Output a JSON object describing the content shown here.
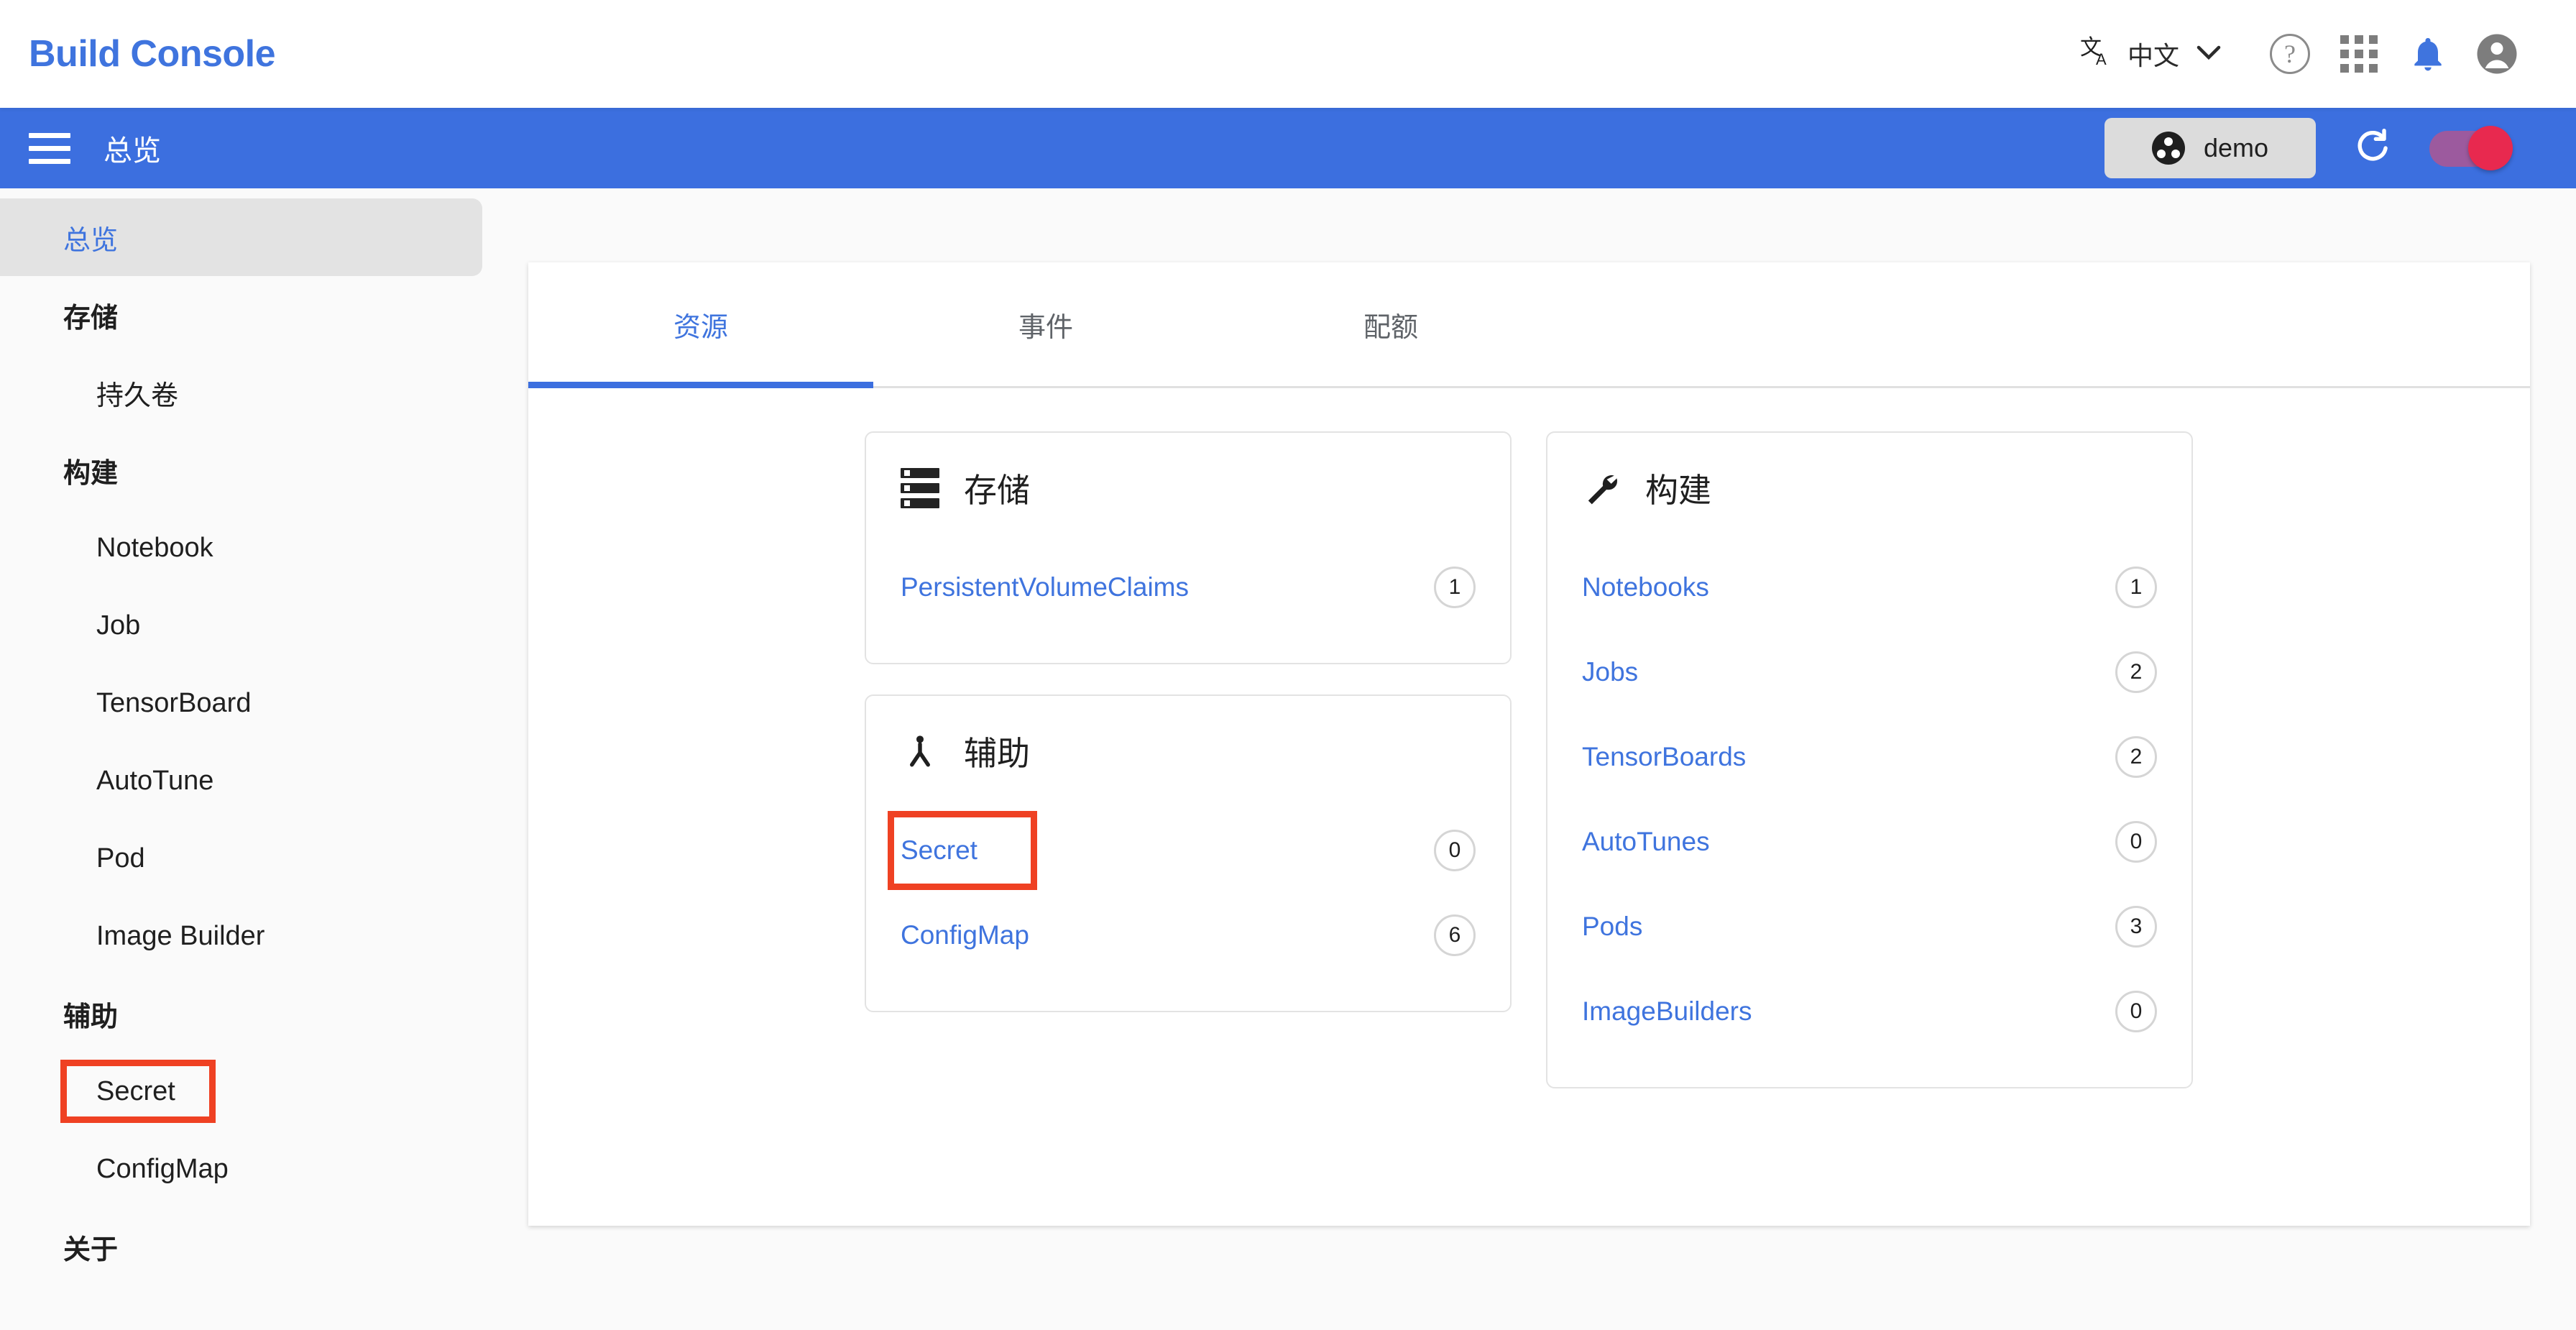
{
  "header": {
    "brand": "Build Console",
    "language_label": "中文",
    "translate_icon": "translate-icon",
    "chevron": "⌄",
    "help_glyph": "?",
    "icons": [
      "translate-icon",
      "help-icon",
      "apps-grid-icon",
      "notifications-bell-icon",
      "account-avatar-icon"
    ]
  },
  "toolbar": {
    "menu_icon": "hamburger-menu-icon",
    "page_title": "总览",
    "namespace": "demo",
    "refresh_icon": "refresh-icon",
    "toggle_state": "on",
    "colors": {
      "bar": "#3c6fdf",
      "toggle_thumb": "#e8294f",
      "toggle_track": "#9c5a9e"
    }
  },
  "sidebar": {
    "items": [
      {
        "label": "总览",
        "type": "item",
        "active": true
      },
      {
        "label": "存储",
        "type": "group"
      },
      {
        "label": "持久卷",
        "type": "child"
      },
      {
        "label": "构建",
        "type": "group"
      },
      {
        "label": "Notebook",
        "type": "child"
      },
      {
        "label": "Job",
        "type": "child"
      },
      {
        "label": "TensorBoard",
        "type": "child"
      },
      {
        "label": "AutoTune",
        "type": "child"
      },
      {
        "label": "Pod",
        "type": "child"
      },
      {
        "label": "Image Builder",
        "type": "child"
      },
      {
        "label": "辅助",
        "type": "group"
      },
      {
        "label": "Secret",
        "type": "child",
        "highlighted": true
      },
      {
        "label": "ConfigMap",
        "type": "child"
      },
      {
        "label": "关于",
        "type": "group"
      }
    ]
  },
  "main": {
    "tabs": [
      {
        "label": "资源",
        "active": true
      },
      {
        "label": "事件",
        "active": false
      },
      {
        "label": "配额",
        "active": false
      }
    ],
    "cards": [
      {
        "title": "存储",
        "icon": "storage-rack-icon",
        "rows": [
          {
            "label": "PersistentVolumeClaims",
            "count": "1",
            "highlighted": false
          }
        ]
      },
      {
        "title": "辅助",
        "icon": "accessibility-person-icon",
        "rows": [
          {
            "label": "Secret",
            "count": "0",
            "highlighted": true
          },
          {
            "label": "ConfigMap",
            "count": "6",
            "highlighted": false
          }
        ]
      },
      {
        "title": "构建",
        "icon": "wrench-icon",
        "rows": [
          {
            "label": "Notebooks",
            "count": "1",
            "highlighted": false
          },
          {
            "label": "Jobs",
            "count": "2",
            "highlighted": false
          },
          {
            "label": "TensorBoards",
            "count": "2",
            "highlighted": false
          },
          {
            "label": "AutoTunes",
            "count": "0",
            "highlighted": false
          },
          {
            "label": "Pods",
            "count": "3",
            "highlighted": false
          },
          {
            "label": "ImageBuilders",
            "count": "0",
            "highlighted": false
          }
        ]
      }
    ]
  },
  "colors": {
    "accent_blue": "#3f74de",
    "toolbar_blue": "#3c6fdf",
    "highlight_red": "#ef4123",
    "page_bg": "#fafafa"
  }
}
